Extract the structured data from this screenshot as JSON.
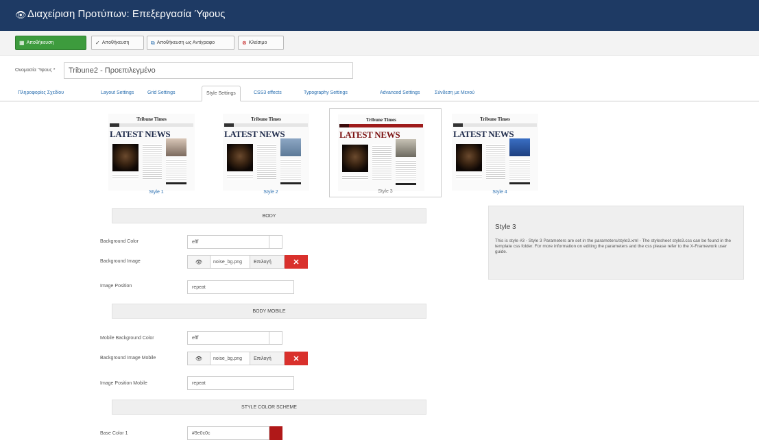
{
  "header": {
    "title": "Διαχείριση Προτύπων: Επεξεργασία Ύφους",
    "icon": "eye-icon"
  },
  "toolbar": {
    "save_label": "Αποθήκευση",
    "save_close_label": "Αποθήκευση",
    "save_copy_label": "Αποθήκευση ως Αντίγραφο",
    "close_label": "Κλείσιμο"
  },
  "style_name": {
    "label": "Ονομασία Ύφους *",
    "value": "Tribune2 - Προεπιλεγμένο"
  },
  "tabs": [
    {
      "label": "Πληροφορίες Σχεδίου"
    },
    {
      "label": "Layout Settings"
    },
    {
      "label": "Grid Settings"
    },
    {
      "label": "Style Settings"
    },
    {
      "label": "CSS3 effects"
    },
    {
      "label": "Typography Settings"
    },
    {
      "label": "Advanced Settings"
    },
    {
      "label": "Σύνδεση με Μενού"
    }
  ],
  "active_tab": "Style Settings",
  "styles": [
    {
      "label": "Style 1",
      "masthead": "Tribune Times",
      "headline": "LATEST NEWS"
    },
    {
      "label": "Style 2",
      "masthead": "Tribune Times",
      "headline": "LATEST NEWS"
    },
    {
      "label": "Style 3",
      "masthead": "Tribune Times",
      "headline": "LATEST NEWS"
    },
    {
      "label": "Style 4",
      "masthead": "Tribune Times",
      "headline": "LATEST NEWS"
    }
  ],
  "selected_style": "Style 3",
  "sections": {
    "body": {
      "title": "BODY",
      "bg_color_label": "Background Color",
      "bg_color_value": "efff",
      "bg_image_label": "Background Image",
      "bg_image_file": "noise_bg.png",
      "select_label": "Επιλογή",
      "image_position_label": "Image Position",
      "image_position_value": "repeat"
    },
    "body_mobile": {
      "title": "BODY MOBILE",
      "bg_color_label": "Mobile Background Color",
      "bg_color_value": "efff",
      "bg_image_label": "Background Image Mobile",
      "bg_image_file": "noise_bg.png",
      "select_label": "Επιλογή",
      "image_position_label": "Image Position Mobile",
      "image_position_value": "repeat"
    },
    "color_scheme": {
      "title": "STYLE COLOR SCHEME",
      "base_color_label": "Base Color 1",
      "base_color_value": "#9e0c0c"
    }
  },
  "info": {
    "title": "Style 3",
    "description": "This is style #3 - Style 3 Parameters are set in the parameters/style3.xml - The stylesheet style3.css can be found in the template css folder. For more information on editing the parameters and the css please refer to the X-Framework user guide."
  },
  "colors": {
    "header_bg": "#1e3a64",
    "save_green": "#3d9b3d",
    "remove_red": "#d9302c",
    "swatch_red": "#b01818"
  }
}
